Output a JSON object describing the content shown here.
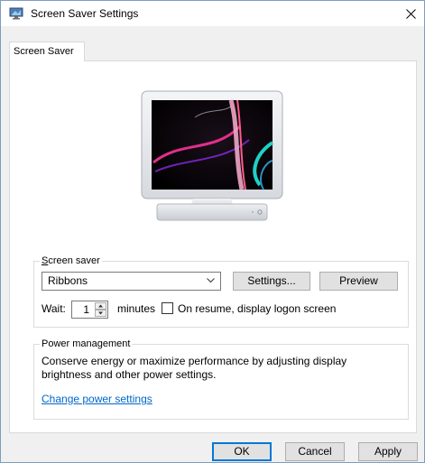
{
  "window": {
    "title": "Screen Saver Settings"
  },
  "tabs": [
    {
      "label": "Screen Saver"
    }
  ],
  "screen_saver": {
    "legend": "Screen saver",
    "selected": "Ribbons",
    "settings_label": "Settings...",
    "preview_label": "Preview",
    "wait_label": "Wait:",
    "wait_value": "1",
    "minutes_label": "minutes",
    "on_resume_label": "On resume, display logon screen",
    "on_resume_checked": false
  },
  "power": {
    "legend": "Power management",
    "description": "Conserve energy or maximize performance by adjusting display brightness and other power settings.",
    "link": "Change power settings"
  },
  "footer": {
    "ok": "OK",
    "cancel": "Cancel",
    "apply": "Apply"
  },
  "colors": {
    "accent": "#0078d7",
    "link": "#0066cc",
    "dialog_bg": "#f0f0f0"
  },
  "icons": {
    "title": "screen-saver-icon",
    "close": "close-icon",
    "dropdown": "chevron-down-icon",
    "spin_up": "spin-up-arrow-icon",
    "spin_down": "spin-down-arrow-icon"
  }
}
